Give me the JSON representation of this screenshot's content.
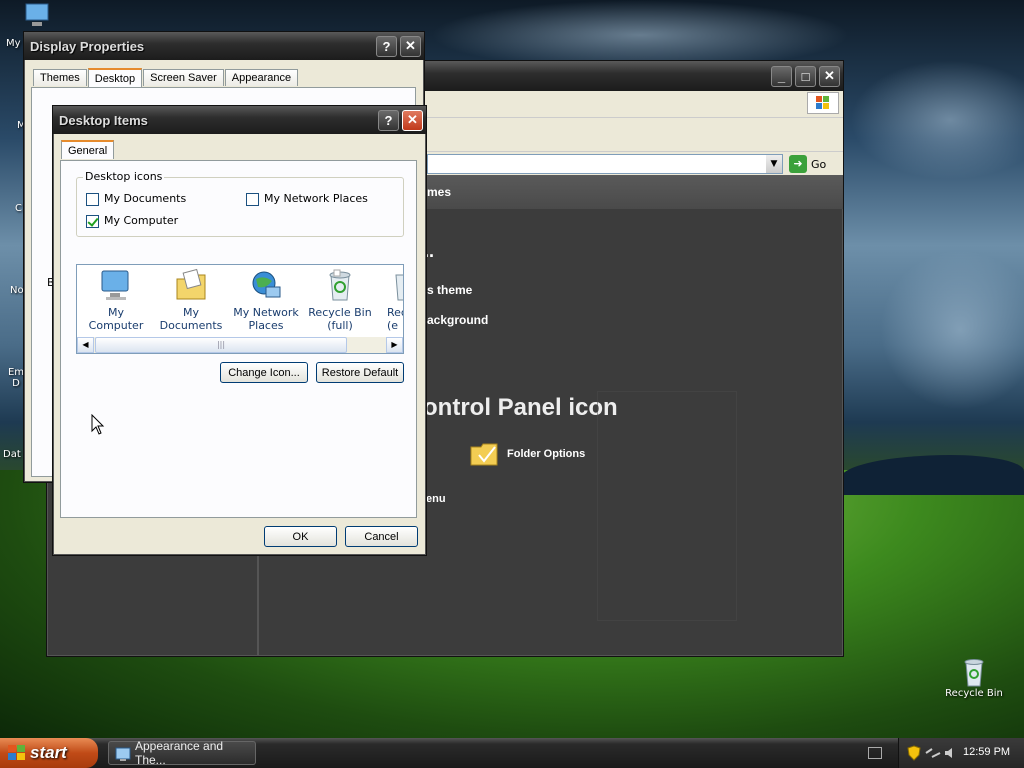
{
  "desktop": {
    "left_icon_labels": [
      "My",
      "M",
      "C",
      "No",
      "Em D",
      "Dat"
    ],
    "recycle_bin_label": "Recycle Bin"
  },
  "display_properties": {
    "title": "Display Properties",
    "tabs": [
      "Themes",
      "Desktop",
      "Screen Saver",
      "Appearance"
    ],
    "active_tab": "Desktop",
    "partial_label": "B"
  },
  "control_panel": {
    "go_label": "Go",
    "heading_partial": "mes",
    "ellipsis": "...",
    "tasks": [
      "s theme",
      "ackground",
      ""
    ],
    "main_heading": "ontrol Panel icon",
    "folder_options": "Folder Options",
    "menu_partial": "lenu"
  },
  "desktop_items": {
    "title": "Desktop Items",
    "tab": "General",
    "group_label": "Desktop icons",
    "checkboxes": [
      {
        "label": "My Documents",
        "checked": false
      },
      {
        "label": "My Network Places",
        "checked": false
      },
      {
        "label": "My Computer",
        "checked": true
      }
    ],
    "icons": [
      {
        "label": "My Computer",
        "icon": "my-computer-icon"
      },
      {
        "label": "My Documents",
        "icon": "my-documents-icon"
      },
      {
        "label": "My Network Places",
        "icon": "network-places-icon"
      },
      {
        "label": "Recycle Bin (full)",
        "icon": "recycle-bin-full-icon"
      },
      {
        "label": "Rec (e",
        "icon": "recycle-bin-empty-icon"
      }
    ],
    "change_icon": "Change Icon...",
    "restore_default": "Restore Default",
    "ok": "OK",
    "cancel": "Cancel"
  },
  "taskbar": {
    "start": "start",
    "task_item": "Appearance and The...",
    "clock": "12:59 PM"
  },
  "colors": {
    "title_dark": "#2e2e2e",
    "cp_background": "#3c3c3c",
    "start_orange": "#c04b17"
  }
}
